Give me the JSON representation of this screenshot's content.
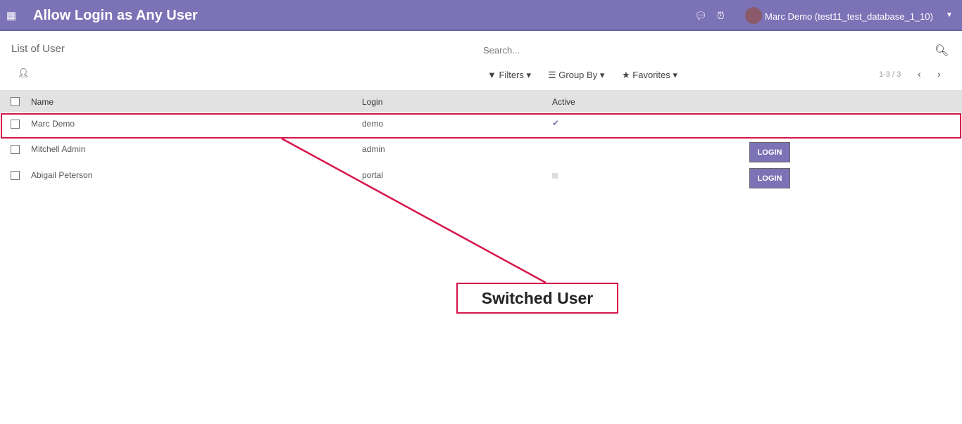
{
  "header": {
    "title": "Allow Login as Any User",
    "user": "Marc Demo (test11_test_database_1_10)",
    "accent": "#7c72b6"
  },
  "breadcrumb": "List of User",
  "search": {
    "placeholder": "Search..."
  },
  "toolbar": {
    "filters": "Filters",
    "group_by": "Group By",
    "favorites": "Favorites",
    "pager": "1-3 / 3"
  },
  "table": {
    "columns": [
      "Name",
      "Login",
      "Active"
    ],
    "rows": [
      {
        "name": "Marc Demo",
        "login": "demo",
        "active": true,
        "button": ""
      },
      {
        "name": "Mitchell Admin",
        "login": "admin",
        "active": true,
        "button": "LOGIN"
      },
      {
        "name": "Abigail Peterson",
        "login": "portal",
        "active": false,
        "button": "LOGIN"
      }
    ]
  },
  "annotation": {
    "label": "Switched User",
    "color": "#d6154b"
  }
}
